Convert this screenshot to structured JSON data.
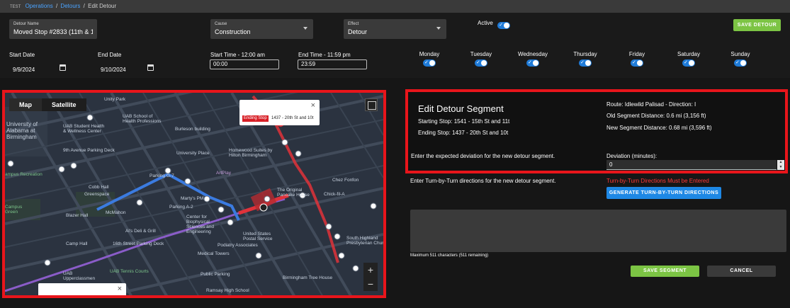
{
  "breadcrumb": {
    "env": "TEST",
    "item1": "Operations",
    "item2": "Detours",
    "current": "Edit Detour"
  },
  "header": {
    "detour_name": {
      "label": "Detour Name",
      "value": "Moved Stop #2833 (11th & 1"
    },
    "cause": {
      "label": "Cause",
      "value": "Construction"
    },
    "effect": {
      "label": "Effect",
      "value": "Detour"
    },
    "active_label": "Active",
    "save_detour": "SAVE DETOUR",
    "start_date": {
      "label": "Start Date",
      "value": "9/9/2024"
    },
    "end_date": {
      "label": "End Date",
      "value": "9/10/2024"
    },
    "start_time": {
      "label": "Start Time - 12:00 am",
      "value": "00:00"
    },
    "end_time": {
      "label": "End Time - 11:59 pm",
      "value": "23:59"
    },
    "days": [
      "Monday",
      "Tuesday",
      "Wednesday",
      "Thursday",
      "Friday",
      "Saturday",
      "Sunday"
    ]
  },
  "map": {
    "tabs": [
      "Map",
      "Satellite"
    ],
    "zoom_in": "+",
    "zoom_out": "−",
    "popup": {
      "tag": "Ending Stop",
      "stop": "1437 - 20th St and 10t",
      "close": "×"
    },
    "popup2_close": "×",
    "pois": {
      "unity_park": "Unity Park",
      "uab_alabama": "University of\nAlabama at\nBirmingham",
      "uab_student": "UAB Student Health\n& Wellness Center",
      "uab_school": "UAB School of\nHealth Professions",
      "burleson": "Burleson building",
      "ninth_ave_parking": "9th Avenue Parking Deck",
      "university_place": "University Place",
      "homewood": "Homewood Suites by\nHilton Birmingham",
      "campus_rec": "ampus Recreation",
      "artplay": "ArtPlay",
      "parking_g7": "Parking G-7",
      "cobb_hall": "Cobb Hall",
      "greenspace": "Greenspace",
      "original_pancake": "The Original\nPancake House",
      "chez_fonfon": "Chez Fonfon",
      "chickfila": "Chick-fil-A",
      "martys": "Marty's PM",
      "parking_a2": "Parking A-2",
      "campus_green": "Campus\nGreen",
      "blazer_hall": "Blazer Hall",
      "mcmahon": "McMahon",
      "center_biophysical": "Center for\nBiophysical\nSciences and\nEngineering",
      "als_deli": "Al's Deli & Grill",
      "usps": "United States\nPostal Service",
      "south_highland": "South Highland\nPresbyterian Church",
      "camp_hall": "Camp Hall",
      "parking_16th": "16th Street Parking Deck",
      "podiatry": "Podiatry Associates",
      "medical_towers": "Medical Towers",
      "uab_tennis": "UAB Tennis Courts",
      "public_parking": "Public Parking",
      "birmingham_tree": "Birmingham Tree House",
      "uab_upperclassmen": "UAB\nUpperclassmen",
      "ramsay": "Ramsay High School"
    }
  },
  "segment": {
    "title": "Edit Detour Segment",
    "starting_stop": "Starting Stop: 1541 - 15th St and 11t",
    "ending_stop": "Ending Stop: 1437 - 20th St and 10t",
    "route": "Route: Idlewild Palisad - Direction: I",
    "old_distance": "Old Segment Distance: 0.6 mi (3,156 ft)",
    "new_distance": "New Segment Distance: 0.68 mi (3,596 ft)",
    "deviation_prompt": "Enter the expected deviation for the new detour segment.",
    "deviation_label": "Deviation (minutes):",
    "deviation_value": "0"
  },
  "turn_by_turn": {
    "prompt": "Enter Turn-by-Turn directions for the new detour segment.",
    "warning": "Turn-by-Turn Directions Must be Entered",
    "generate": "GENERATE TURN-BY-TURN DIRECTIONS",
    "max_chars": "Maximum 511 characters (511 remaining)",
    "save_segment": "SAVE SEGMENT",
    "cancel": "CANCEL"
  },
  "colors": {
    "accent_green": "#7cc444",
    "accent_blue": "#1e88e5",
    "highlight_red": "#e8151b",
    "route_blue": "#3b7be0",
    "route_red": "#e0323a",
    "route_purple": "#8a5cc8"
  }
}
